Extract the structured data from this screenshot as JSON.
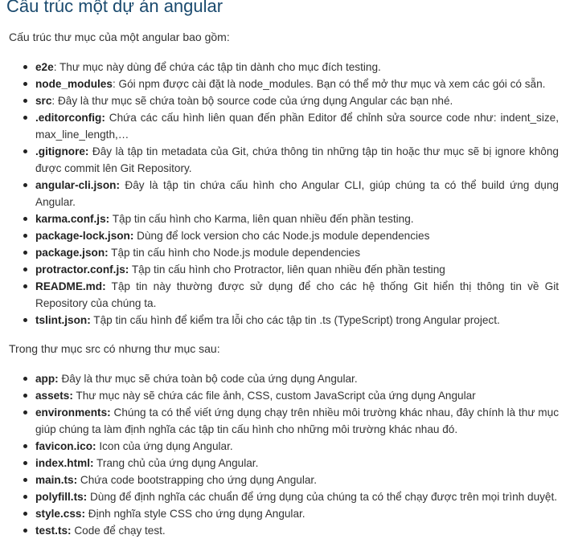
{
  "title": "Cấu trúc một dự án angular",
  "intro_root": "Cấu trúc thư mục của một angular bao gồm:",
  "root_items": [
    {
      "term": "e2e",
      "desc": ": Thư mục này dùng để chứa các tập tin dành cho mục đích testing."
    },
    {
      "term": "node_modules",
      "desc": ": Gói npm được cài đặt là node_modules. Bạn có thể mở thư mục và xem các gói có sẵn."
    },
    {
      "term": "src",
      "desc": ": Đây là thư mục sẽ chứa toàn bộ source code của ứng dụng Angular các bạn nhé."
    },
    {
      "term": ".editorconfig:",
      "desc": " Chứa các cấu hình liên quan đến phần Editor để chỉnh sửa source code như: indent_size, max_line_length,…"
    },
    {
      "term": ".gitignore:",
      "desc": " Đây là tập tin metadata của Git, chứa thông tin những tập tin hoặc thư mục sẽ bị ignore không được commit lên Git Repository."
    },
    {
      "term": "angular-cli.json:",
      "desc": " Đây là tập tin chứa cấu hình cho Angular CLI, giúp chúng ta có thể build ứng dụng Angular."
    },
    {
      "term": "karma.conf.js:",
      "desc": " Tập tin cấu hình cho Karma, liên quan nhiều đến phần testing."
    },
    {
      "term": "package-lock.json:",
      "desc": " Dùng để lock version cho các Node.js module dependencies"
    },
    {
      "term": "package.json:",
      "desc": " Tập tin cấu hình cho Node.js module dependencies"
    },
    {
      "term": "protractor.conf.js:",
      "desc": " Tập tin cấu hình cho Protractor, liên quan nhiều đến phần testing"
    },
    {
      "term": "README.md:",
      "desc": " Tập tin này thường được sử dụng để cho các hệ thống Git hiển thị thông tin về Git Repository của chúng ta."
    },
    {
      "term": "tslint.json:",
      "desc": " Tập tin cấu hình để kiểm tra lỗi cho các tập tin .ts (TypeScript) trong Angular project."
    }
  ],
  "intro_src": "Trong thư mục src có nhưng thư mục sau:",
  "src_items": [
    {
      "term": "app:",
      "desc": " Đây là thư mục sẽ chứa toàn bộ code của ứng dụng Angular."
    },
    {
      "term": "assets:",
      "desc": " Thư mục này sẽ chứa các file ảnh, CSS, custom JavaScript của ứng dụng Angular"
    },
    {
      "term": "environments:",
      "desc": " Chúng ta có thể viết ứng dụng chạy trên nhiều môi trường khác nhau, đây chính là thư mục giúp chúng ta làm định nghĩa các tập tin cấu hình cho những môi trường khác nhau đó."
    },
    {
      "term": "favicon.ico:",
      "desc": " Icon của ứng dụng Angular."
    },
    {
      "term": "index.html:",
      "desc": " Trang chủ của ứng dụng Angular."
    },
    {
      "term": "main.ts:",
      "desc": " Chứa code bootstrapping cho ứng dụng Angular."
    },
    {
      "term": "polyfill.ts:",
      "desc": " Dùng để định nghĩa các chuẩn để ứng dụng của chúng ta có thể chạy được trên mọi trình duyệt."
    },
    {
      "term": "style.css:",
      "desc": " Định nghĩa style CSS cho ứng dụng Angular."
    },
    {
      "term": "test.ts:",
      "desc": " Code để chạy test."
    }
  ]
}
